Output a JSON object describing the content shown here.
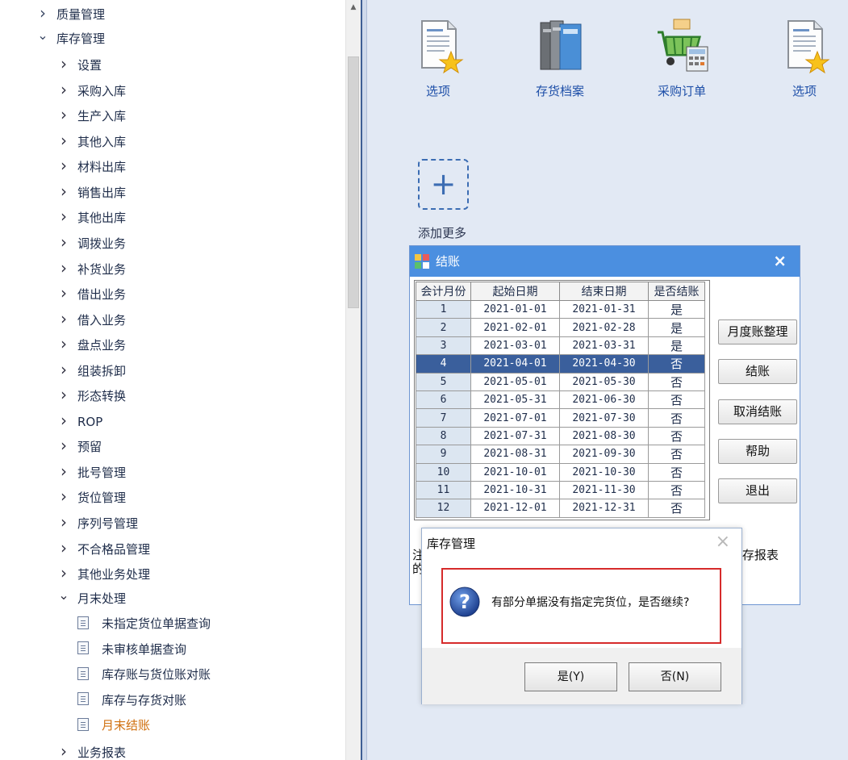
{
  "sidebar": {
    "items": [
      {
        "label": "质量管理",
        "level": 0,
        "state": "collapsed"
      },
      {
        "label": "库存管理",
        "level": 0,
        "state": "expanded"
      },
      {
        "label": "设置",
        "level": 1,
        "state": "collapsed"
      },
      {
        "label": "采购入库",
        "level": 1,
        "state": "collapsed"
      },
      {
        "label": "生产入库",
        "level": 1,
        "state": "collapsed"
      },
      {
        "label": "其他入库",
        "level": 1,
        "state": "collapsed"
      },
      {
        "label": "材料出库",
        "level": 1,
        "state": "collapsed"
      },
      {
        "label": "销售出库",
        "level": 1,
        "state": "collapsed"
      },
      {
        "label": "其他出库",
        "level": 1,
        "state": "collapsed"
      },
      {
        "label": "调拨业务",
        "level": 1,
        "state": "collapsed"
      },
      {
        "label": "补货业务",
        "level": 1,
        "state": "collapsed"
      },
      {
        "label": "借出业务",
        "level": 1,
        "state": "collapsed"
      },
      {
        "label": "借入业务",
        "level": 1,
        "state": "collapsed"
      },
      {
        "label": "盘点业务",
        "level": 1,
        "state": "collapsed"
      },
      {
        "label": "组装拆卸",
        "level": 1,
        "state": "collapsed"
      },
      {
        "label": "形态转换",
        "level": 1,
        "state": "collapsed"
      },
      {
        "label": "ROP",
        "level": 1,
        "state": "collapsed"
      },
      {
        "label": "预留",
        "level": 1,
        "state": "collapsed"
      },
      {
        "label": "批号管理",
        "level": 1,
        "state": "collapsed"
      },
      {
        "label": "货位管理",
        "level": 1,
        "state": "collapsed"
      },
      {
        "label": "序列号管理",
        "level": 1,
        "state": "collapsed"
      },
      {
        "label": "不合格品管理",
        "level": 1,
        "state": "collapsed"
      },
      {
        "label": "其他业务处理",
        "level": 1,
        "state": "collapsed"
      },
      {
        "label": "月末处理",
        "level": 1,
        "state": "expanded"
      },
      {
        "label": "未指定货位单据查询",
        "level": 2,
        "state": "leaf"
      },
      {
        "label": "未审核单据查询",
        "level": 2,
        "state": "leaf"
      },
      {
        "label": "库存账与货位账对账",
        "level": 2,
        "state": "leaf"
      },
      {
        "label": "库存与存货对账",
        "level": 2,
        "state": "leaf"
      },
      {
        "label": "月末结账",
        "level": 2,
        "state": "leaf",
        "active": true
      },
      {
        "label": "业务报表",
        "level": 1,
        "state": "collapsed"
      }
    ]
  },
  "shortcuts": [
    {
      "label": "选项",
      "icon": "document-star-icon"
    },
    {
      "label": "存货档案",
      "icon": "binders-icon"
    },
    {
      "label": "采购订单",
      "icon": "shopping-basket-icon"
    },
    {
      "label": "选项",
      "icon": "document-star-icon"
    }
  ],
  "add_more": {
    "symbol": "+",
    "label": "添加更多"
  },
  "close_dialog": {
    "title": "结账",
    "columns": [
      "会计月份",
      "起始日期",
      "结束日期",
      "是否结账"
    ],
    "rows": [
      {
        "month": "1",
        "start": "2021-01-01",
        "end": "2021-01-31",
        "closed": "是"
      },
      {
        "month": "2",
        "start": "2021-02-01",
        "end": "2021-02-28",
        "closed": "是"
      },
      {
        "month": "3",
        "start": "2021-03-01",
        "end": "2021-03-31",
        "closed": "是"
      },
      {
        "month": "4",
        "start": "2021-04-01",
        "end": "2021-04-30",
        "closed": "否",
        "selected": true
      },
      {
        "month": "5",
        "start": "2021-05-01",
        "end": "2021-05-30",
        "closed": "否"
      },
      {
        "month": "6",
        "start": "2021-05-31",
        "end": "2021-06-30",
        "closed": "否"
      },
      {
        "month": "7",
        "start": "2021-07-01",
        "end": "2021-07-30",
        "closed": "否"
      },
      {
        "month": "8",
        "start": "2021-07-31",
        "end": "2021-08-30",
        "closed": "否"
      },
      {
        "month": "9",
        "start": "2021-08-31",
        "end": "2021-09-30",
        "closed": "否"
      },
      {
        "month": "10",
        "start": "2021-10-01",
        "end": "2021-10-30",
        "closed": "否"
      },
      {
        "month": "11",
        "start": "2021-10-31",
        "end": "2021-11-30",
        "closed": "否"
      },
      {
        "month": "12",
        "start": "2021-12-01",
        "end": "2021-12-31",
        "closed": "否"
      }
    ],
    "buttons": [
      "月度账整理",
      "结账",
      "取消结账",
      "帮助",
      "退出"
    ],
    "note_left": "注\n的",
    "note_right": "z存报表"
  },
  "confirm_dialog": {
    "title": "库存管理",
    "close_symbol": "×",
    "message": "有部分单据没有指定完货位，是否继续?",
    "yes_label": "是(Y)",
    "no_label": "否(N)",
    "highlight_color": "#d62b2b"
  },
  "colors": {
    "workspace_bg": "#e2e9f4",
    "titlebar": "#4b8fe0",
    "selected_row": "#3a5f9c",
    "link_text": "#1e4fa8",
    "active_tree_item": "#d0700f"
  }
}
